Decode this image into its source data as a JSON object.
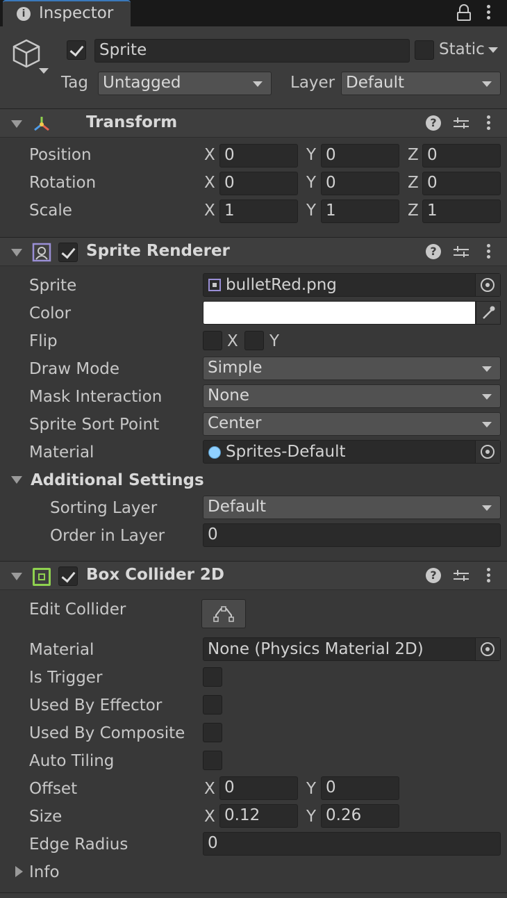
{
  "window": {
    "tab_label": "Inspector",
    "icons": [
      "info-icon",
      "lock-icon",
      "kebab-icon"
    ]
  },
  "header": {
    "object_active": true,
    "object_name": "Sprite",
    "static_label": "Static",
    "static_checked": false,
    "tag_label": "Tag",
    "tag_value": "Untagged",
    "layer_label": "Layer",
    "layer_value": "Default"
  },
  "transform": {
    "title": "Transform",
    "rows": [
      {
        "label": "Position",
        "x": "0",
        "y": "0",
        "z": "0"
      },
      {
        "label": "Rotation",
        "x": "0",
        "y": "0",
        "z": "0"
      },
      {
        "label": "Scale",
        "x": "1",
        "y": "1",
        "z": "1"
      }
    ],
    "axis_x": "X",
    "axis_y": "Y",
    "axis_z": "Z"
  },
  "sprite_renderer": {
    "title": "Sprite Renderer",
    "enabled": true,
    "sprite_label": "Sprite",
    "sprite_value": "bulletRed.png",
    "color_label": "Color",
    "color_value": "#ffffff",
    "flip_label": "Flip",
    "flip_x": "X",
    "flip_y": "Y",
    "draw_mode_label": "Draw Mode",
    "draw_mode_value": "Simple",
    "mask_label": "Mask Interaction",
    "mask_value": "None",
    "sort_point_label": "Sprite Sort Point",
    "sort_point_value": "Center",
    "material_label": "Material",
    "material_value": "Sprites-Default",
    "additional_title": "Additional Settings",
    "sorting_layer_label": "Sorting Layer",
    "sorting_layer_value": "Default",
    "order_label": "Order in Layer",
    "order_value": "0"
  },
  "box_collider": {
    "title": "Box Collider 2D",
    "enabled": true,
    "edit_label": "Edit Collider",
    "material_label": "Material",
    "material_value": "None (Physics Material 2D)",
    "trigger_label": "Is Trigger",
    "effector_label": "Used By Effector",
    "composite_label": "Used By Composite",
    "tiling_label": "Auto Tiling",
    "offset_label": "Offset",
    "offset_x": "0",
    "offset_y": "0",
    "size_label": "Size",
    "size_x": "0.12",
    "size_y": "0.26",
    "radius_label": "Edge Radius",
    "radius_value": "0",
    "info_label": "Info"
  }
}
